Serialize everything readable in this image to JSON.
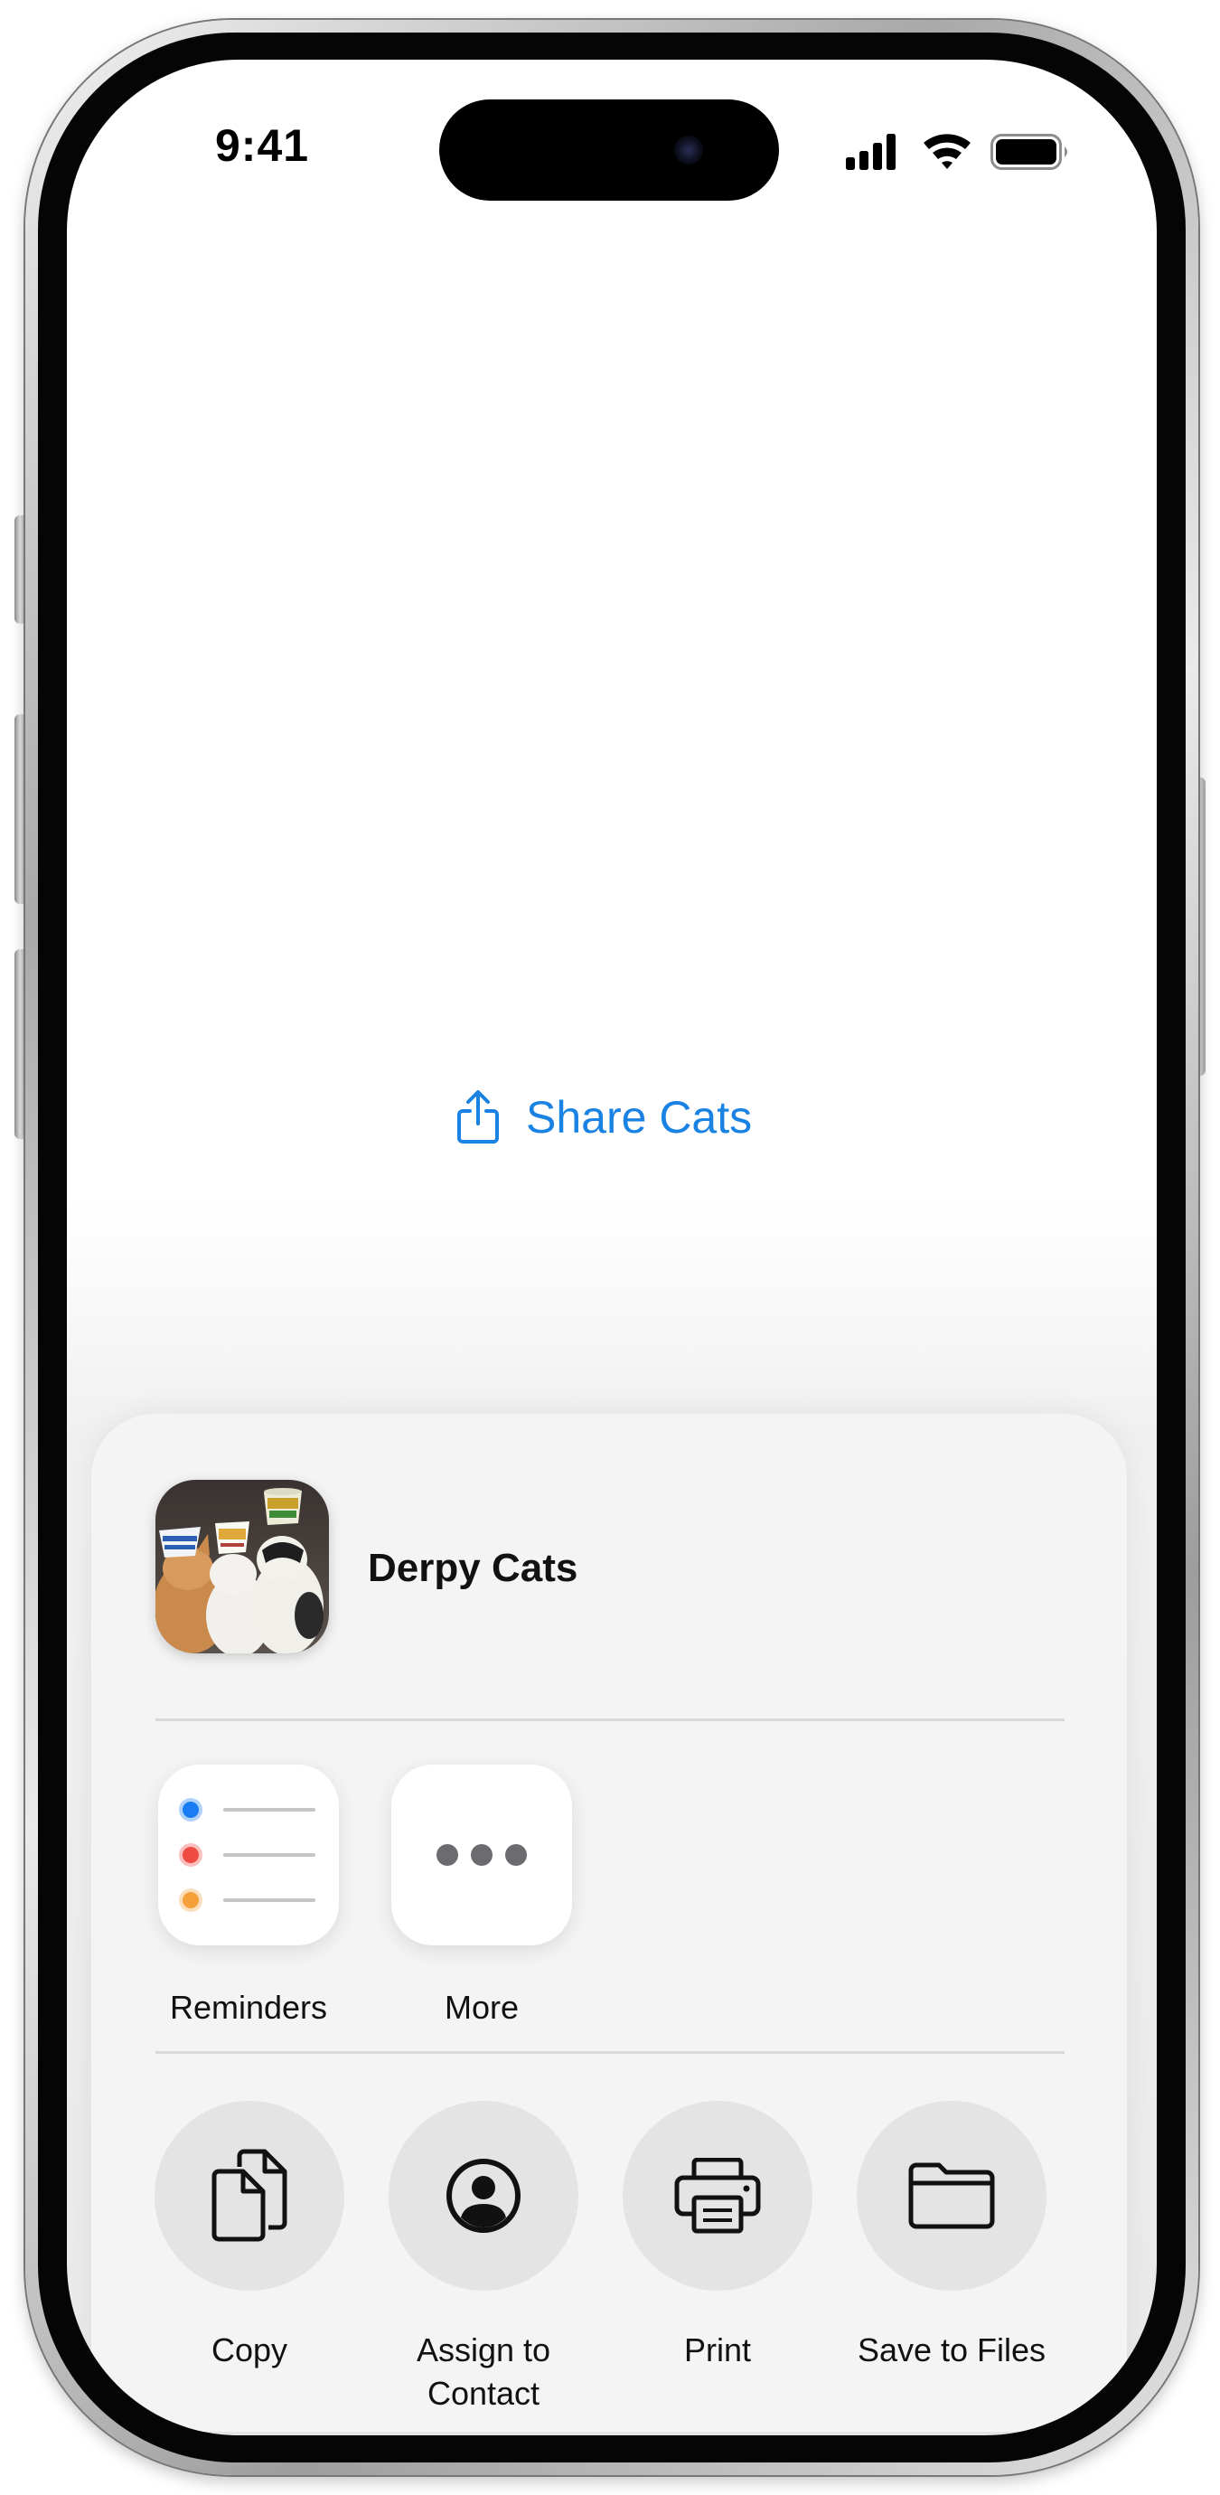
{
  "status_bar": {
    "time": "9:41",
    "icons": [
      "cellular-signal-icon",
      "wifi-icon",
      "battery-icon"
    ]
  },
  "main": {
    "share_button": {
      "icon": "share-icon",
      "label": "Share Cats"
    }
  },
  "share_sheet": {
    "item_title": "Derpy Cats",
    "item_thumbnail": "cats-wearing-cup-hats-photo",
    "apps": [
      {
        "label": "Reminders",
        "icon": "reminders-icon"
      },
      {
        "label": "More",
        "icon": "more-icon"
      }
    ],
    "actions": [
      {
        "label": "Copy",
        "icon": "copy-icon"
      },
      {
        "label": "Assign to Contact",
        "label_lines": [
          "Assign to",
          "Contact"
        ],
        "icon": "person-circle-icon"
      },
      {
        "label": "Print",
        "icon": "printer-icon"
      },
      {
        "label": "Save to Files",
        "icon": "folder-icon"
      }
    ]
  },
  "colors": {
    "accent": "#1a82e2",
    "sheet_background": "#f4f4f4",
    "action_circle": "#e4e4e4",
    "reminder_dots": [
      "#1a7cf2",
      "#ee4b43",
      "#f4a03b"
    ]
  }
}
